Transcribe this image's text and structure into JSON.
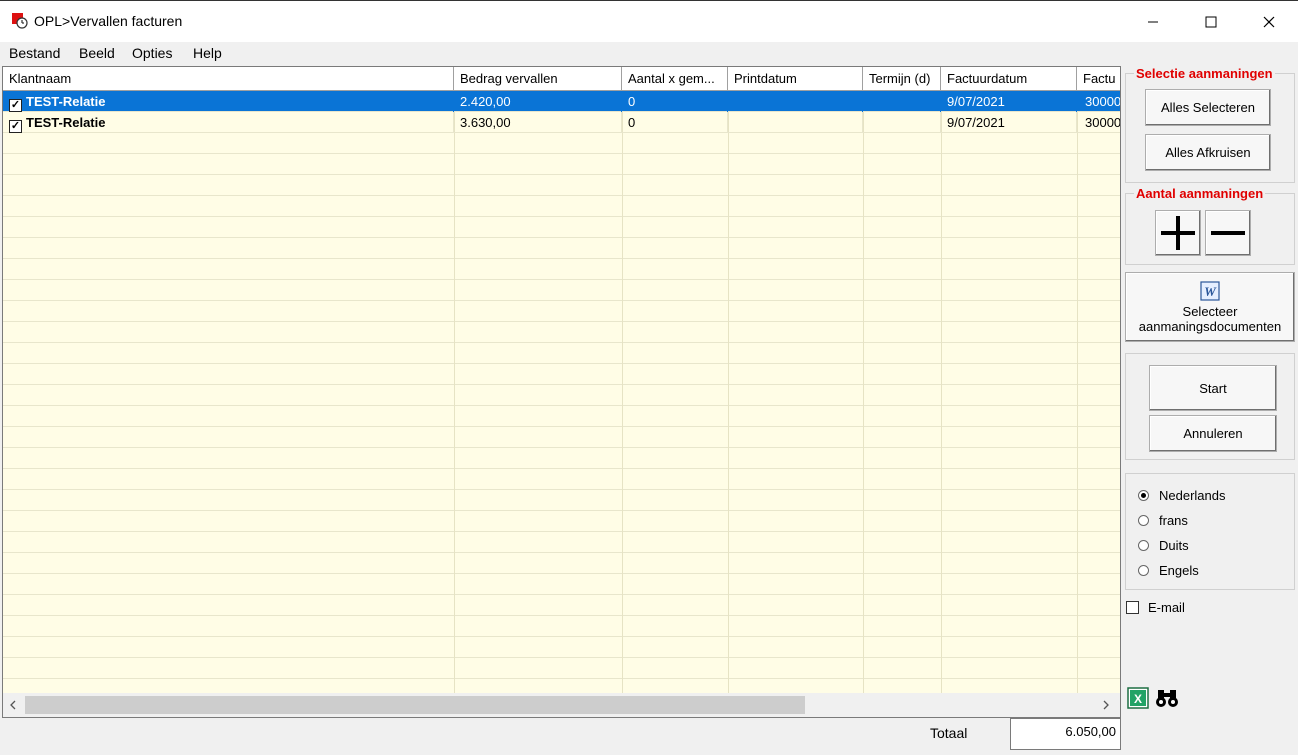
{
  "window": {
    "title": "OPL>Vervallen facturen"
  },
  "menu": [
    "Bestand",
    "Beeld",
    "Opties",
    "Help"
  ],
  "grid": {
    "columns": [
      "Klantnaam",
      "Bedrag vervallen",
      "Aantal x gem...",
      "Printdatum",
      "Termijn (d)",
      "Factuurdatum",
      "Factu"
    ],
    "rows": [
      {
        "checked": true,
        "klantnaam": "TEST-Relatie",
        "bedrag": "2.420,00",
        "aantal": "0",
        "printdatum": "",
        "termijn": "",
        "factuurdatum": "9/07/2021",
        "factu": "30000"
      },
      {
        "checked": true,
        "klantnaam": "TEST-Relatie",
        "bedrag": "3.630,00",
        "aantal": "0",
        "printdatum": "",
        "termijn": "",
        "factuurdatum": "9/07/2021",
        "factu": "30000"
      }
    ]
  },
  "panel": {
    "selectie_title": "Selectie aanmaningen",
    "alles_selecteren": "Alles Selecteren",
    "alles_afkruisen": "Alles Afkruisen",
    "aantal_title": "Aantal aanmaningen",
    "selecteer_docs_line1": "Selecteer",
    "selecteer_docs_line2": "aanmaningsdocumenten",
    "start": "Start",
    "annuleren": "Annuleren",
    "languages": [
      {
        "label": "Nederlands",
        "selected": true
      },
      {
        "label": "frans",
        "selected": false
      },
      {
        "label": "Duits",
        "selected": false
      },
      {
        "label": "Engels",
        "selected": false
      }
    ],
    "email_label": "E-mail",
    "email_checked": false
  },
  "footer": {
    "totaal_label": "Totaal",
    "totaal_value": "6.050,00"
  },
  "colors": {
    "selected_row": "#0a74d6",
    "grid_bg": "#fffde6",
    "group_title": "#e00000"
  }
}
